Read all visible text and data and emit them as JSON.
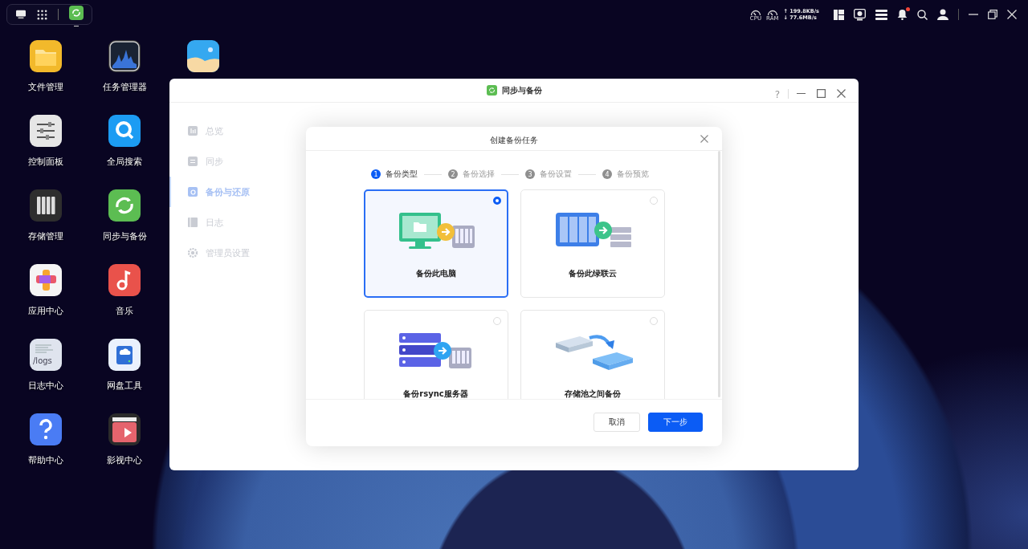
{
  "top_bar": {
    "running_app_indicator": true
  },
  "system_tray": {
    "cpu_label": "CPU",
    "ram_label": "RAM",
    "upload": "↑ 199.8KB/s",
    "download": "↓ 77.6MB/s",
    "notifications_unread": true
  },
  "desktop_icons": [
    {
      "kind": "folder",
      "label": "文件管理"
    },
    {
      "kind": "control-panel",
      "label": "控制面板"
    },
    {
      "kind": "storage",
      "label": "存储管理"
    },
    {
      "kind": "app-center",
      "label": "应用中心"
    },
    {
      "kind": "logs",
      "label": "日志中心",
      "icon_text": "/logs"
    },
    {
      "kind": "help",
      "label": "帮助中心"
    },
    {
      "kind": "activity",
      "label": "任务管理器"
    },
    {
      "kind": "search",
      "label": "全局搜索"
    },
    {
      "kind": "sync",
      "label": "同步与备份"
    },
    {
      "kind": "music",
      "label": "音乐"
    },
    {
      "kind": "drive",
      "label": "网盘工具"
    },
    {
      "kind": "video",
      "label": "影视中心"
    },
    {
      "kind": "photos"
    }
  ],
  "window": {
    "title": "同步与备份",
    "help": "?",
    "sidebar": {
      "items": [
        {
          "kind": "overview",
          "label": "总览",
          "selected": false
        },
        {
          "kind": "sync",
          "label": "同步",
          "selected": false
        },
        {
          "kind": "backup",
          "label": "备份与还原",
          "selected": true
        },
        {
          "kind": "log",
          "label": "日志",
          "selected": false
        },
        {
          "kind": "settings",
          "label": "管理员设置",
          "selected": false
        }
      ]
    }
  },
  "dialog": {
    "title": "创建备份任务",
    "steps": [
      {
        "number": "1",
        "label": "备份类型",
        "active": true
      },
      {
        "number": "2",
        "label": "备份选择",
        "active": false
      },
      {
        "number": "3",
        "label": "备份设置",
        "active": false
      },
      {
        "number": "4",
        "label": "备份预览",
        "active": false
      }
    ],
    "options": [
      {
        "kind": "computer",
        "label": "备份此电脑",
        "selected": true
      },
      {
        "kind": "nas",
        "label": "备份此绿联云",
        "selected": false
      },
      {
        "kind": "rsync",
        "label": "备份rsync服务器",
        "selected": false
      },
      {
        "kind": "pool",
        "label": "存储池之间备份",
        "selected": false
      }
    ],
    "buttons": [
      {
        "kind": "secondary",
        "label": "取消"
      },
      {
        "kind": "primary",
        "label": "下一步"
      }
    ]
  }
}
